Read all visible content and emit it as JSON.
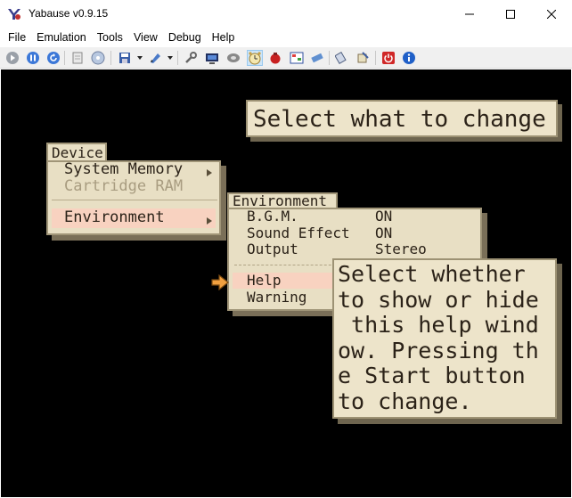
{
  "window": {
    "title": "Yabause v0.9.15",
    "controls": [
      "minimize",
      "maximize",
      "close"
    ]
  },
  "menubar": {
    "items": [
      "File",
      "Emulation",
      "Tools",
      "View",
      "Debug",
      "Help"
    ]
  },
  "toolbar": {
    "buttons": [
      "play-icon",
      "pause-icon",
      "reset-icon",
      "open-iso-icon",
      "open-cd-icon",
      "save-state-icon",
      "load-state-icon",
      "settings-icon",
      "vdp-icon",
      "cd-drive-icon",
      "clock-icon",
      "record-icon",
      "screenshot-icon",
      "memory-icon",
      "transfer-icon",
      "cheat-icon",
      "power-icon",
      "about-icon"
    ],
    "pressed": "clock-icon"
  },
  "game": {
    "prompt": "Select what to change",
    "device_menu": {
      "tab": "Device",
      "items": [
        {
          "label": "System Memory",
          "enabled": true,
          "has_submenu": true
        },
        {
          "label": "Cartridge RAM",
          "enabled": false
        },
        {
          "label": "Environment",
          "enabled": true,
          "selected": true,
          "has_submenu": true
        }
      ]
    },
    "environment_menu": {
      "tab": "Environment",
      "settings": [
        {
          "label": "B.G.M.",
          "value": "ON"
        },
        {
          "label": "Sound Effect",
          "value": "ON"
        },
        {
          "label": "Output",
          "value": "Stereo"
        }
      ],
      "options": [
        {
          "label": "Help",
          "selected": true
        },
        {
          "label": "Warning"
        }
      ]
    },
    "help_text": "Select whether\nto show or hide\n this help wind\now. Pressing th\ne Start button\nto change."
  },
  "colors": {
    "panel": "#e8dfc4",
    "panel_border": "#a09578",
    "highlight": "#f8d2c0",
    "text": "#2b2218",
    "cursor": "#f0a040"
  }
}
